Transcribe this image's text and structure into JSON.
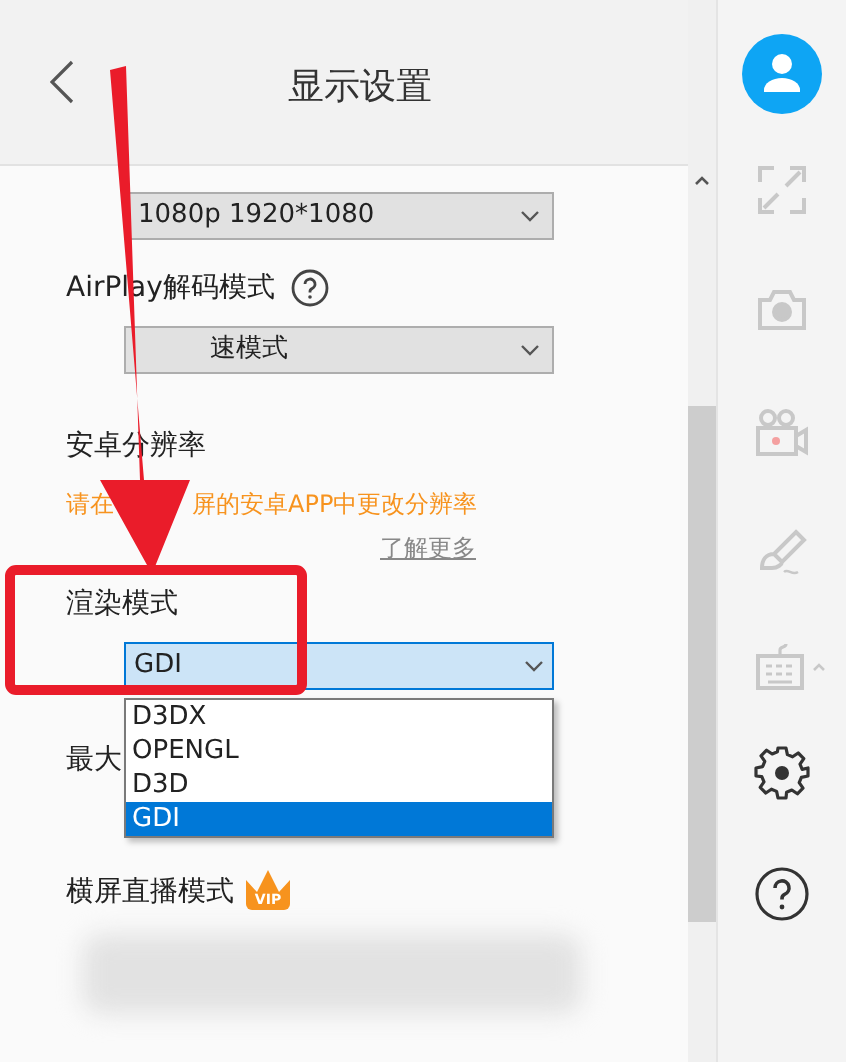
{
  "header": {
    "title": "显示设置"
  },
  "resolution_select": {
    "value": "1080p 1920*1080"
  },
  "airplay": {
    "label": "AirPlay解码模式"
  },
  "airplay_select": {
    "value": "速模式"
  },
  "android": {
    "label": "安卓分辨率",
    "notice_parts": [
      "请在",
      "屏的安卓APP中更改分辨率"
    ],
    "link": "了解更多"
  },
  "render": {
    "label": "渲染模式",
    "value": "GDI",
    "options": [
      {
        "label": "D3DX",
        "selected": false
      },
      {
        "label": "OPENGL",
        "selected": false
      },
      {
        "label": "D3D",
        "selected": false
      },
      {
        "label": "GDI",
        "selected": true
      }
    ]
  },
  "max": {
    "label": "最大"
  },
  "landscape": {
    "label": "横屏直播模式",
    "badge": "VIP"
  }
}
